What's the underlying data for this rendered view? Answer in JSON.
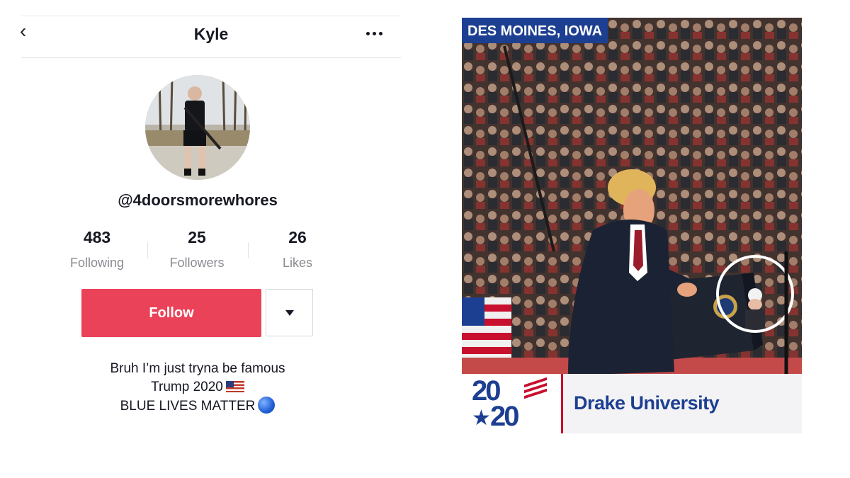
{
  "profile": {
    "name": "Kyle",
    "handle": "@4doorsmorewhores",
    "stats": [
      {
        "value": "483",
        "label": "Following"
      },
      {
        "value": "25",
        "label": "Followers"
      },
      {
        "value": "26",
        "label": "Likes"
      }
    ],
    "follow_label": "Follow",
    "bio": [
      "Bruh I’m just tryna be famous",
      "Trump 2020",
      "BLUE LIVES MATTER"
    ]
  },
  "news": {
    "location": "DES MOINES, IOWA",
    "logo": {
      "line1": "20",
      "line2": "20"
    },
    "venue": "Drake University"
  },
  "colors": {
    "follow": "#ea4359",
    "news_blue": "#1d3f91",
    "news_red": "#c8102e"
  }
}
